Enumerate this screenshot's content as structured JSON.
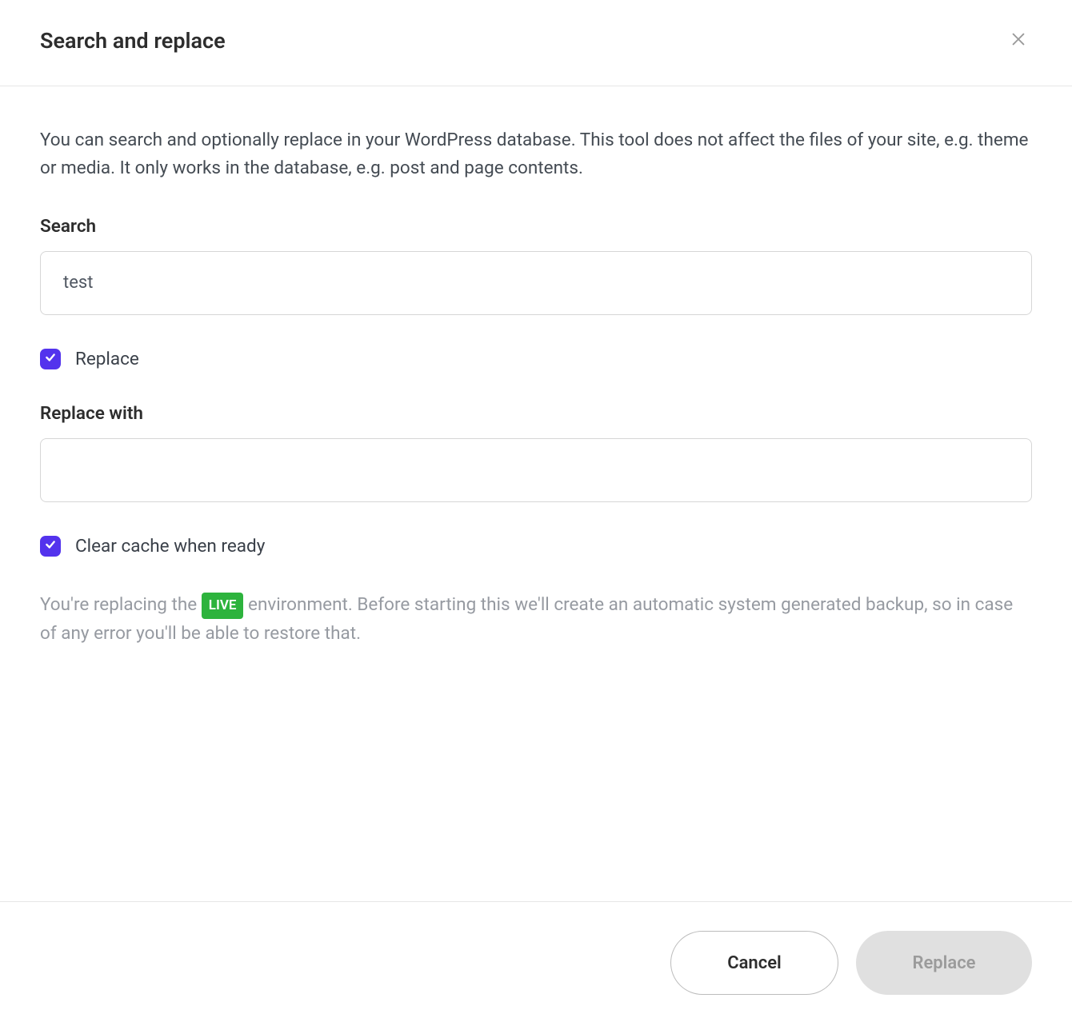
{
  "header": {
    "title": "Search and replace"
  },
  "body": {
    "intro": "You can search and optionally replace in your WordPress database. This tool does not affect the files of your site, e.g. theme or media. It only works in the database, e.g. post and page contents.",
    "search_label": "Search",
    "search_value": "test",
    "replace_checkbox_label": "Replace",
    "replace_with_label": "Replace with",
    "replace_with_value": "",
    "clear_cache_label": "Clear cache when ready",
    "note_before": "You're replacing the ",
    "note_badge": "LIVE",
    "note_after": " environment. Before starting this we'll create an automatic system generated backup, so in case of any error you'll be able to restore that."
  },
  "footer": {
    "cancel_label": "Cancel",
    "replace_label": "Replace"
  }
}
